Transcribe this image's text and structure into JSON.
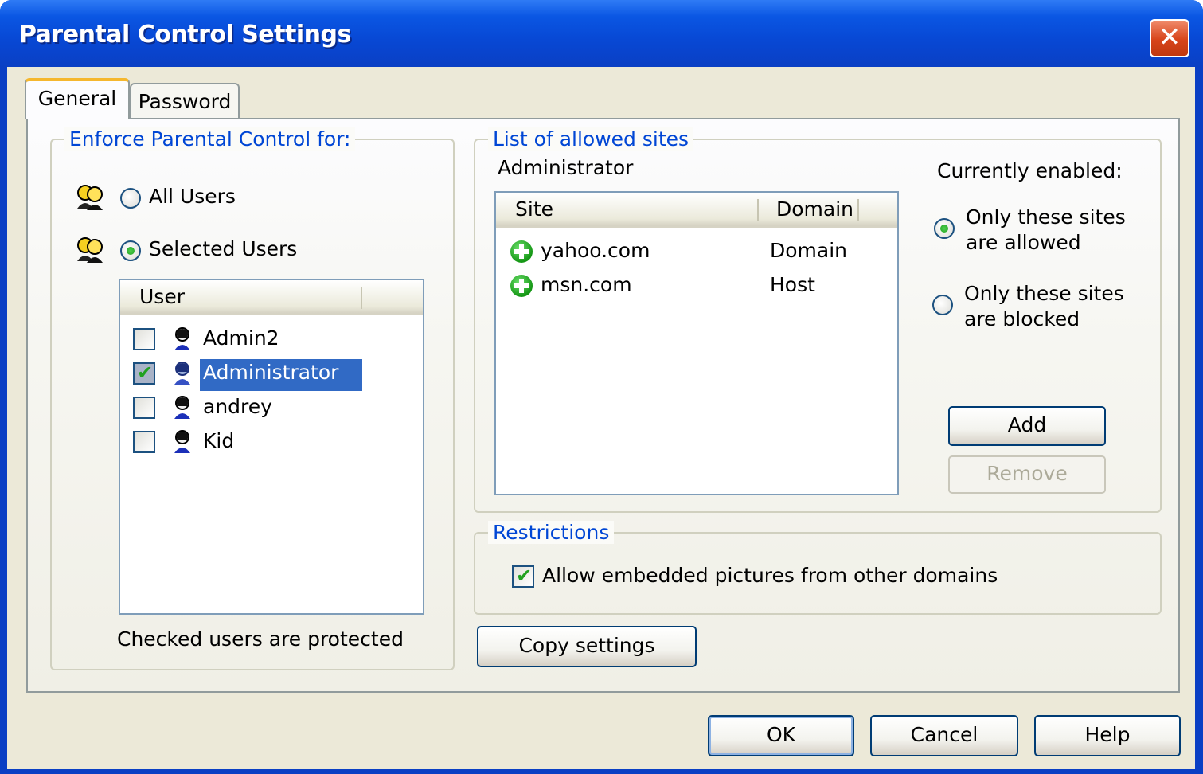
{
  "window": {
    "title": "Parental Control Settings",
    "close_glyph": "✕"
  },
  "tabs": [
    {
      "label": "General"
    },
    {
      "label": "Password"
    }
  ],
  "enforce": {
    "group_title": "Enforce Parental Control for:",
    "all_users_label": "All Users",
    "selected_users_label": "Selected Users",
    "selected_option": "Selected Users",
    "user_list_header": "User",
    "users": [
      {
        "name": "Admin2",
        "checked": false,
        "selected": false
      },
      {
        "name": "Administrator",
        "checked": true,
        "selected": true
      },
      {
        "name": "andrey",
        "checked": false,
        "selected": false
      },
      {
        "name": "Kid",
        "checked": false,
        "selected": false
      }
    ],
    "footer_note": "Checked users are protected"
  },
  "allowed_sites": {
    "group_title": "List of allowed sites",
    "current_user": "Administrator",
    "columns": [
      "Site",
      "Domain"
    ],
    "rows": [
      {
        "site": "yahoo.com",
        "domain": "Domain"
      },
      {
        "site": "msn.com",
        "domain": "Host"
      }
    ],
    "currently_enabled_label": "Currently enabled:",
    "mode_allowed_line1": "Only these sites",
    "mode_allowed_line2": "are allowed",
    "mode_blocked_line1": "Only these sites",
    "mode_blocked_line2": "are blocked",
    "selected_mode": "allowed",
    "add_label": "Add",
    "remove_label": "Remove"
  },
  "restrictions": {
    "group_title": "Restrictions",
    "embedded_pictures_label": "Allow embedded pictures from other domains",
    "embedded_pictures_checked": true
  },
  "copy_settings_label": "Copy settings",
  "dialog_buttons": {
    "ok": "OK",
    "cancel": "Cancel",
    "help": "Help"
  },
  "icons": {
    "group": "user-group-icon",
    "user": "user-icon",
    "site": "plus-circle-icon",
    "check": "✔"
  },
  "colors": {
    "title_bar": "#0a56e3",
    "group_title": "#0046d5",
    "selection": "#316ac5",
    "tab_highlight": "#f5b72e",
    "radio_dot": "#21a121"
  }
}
